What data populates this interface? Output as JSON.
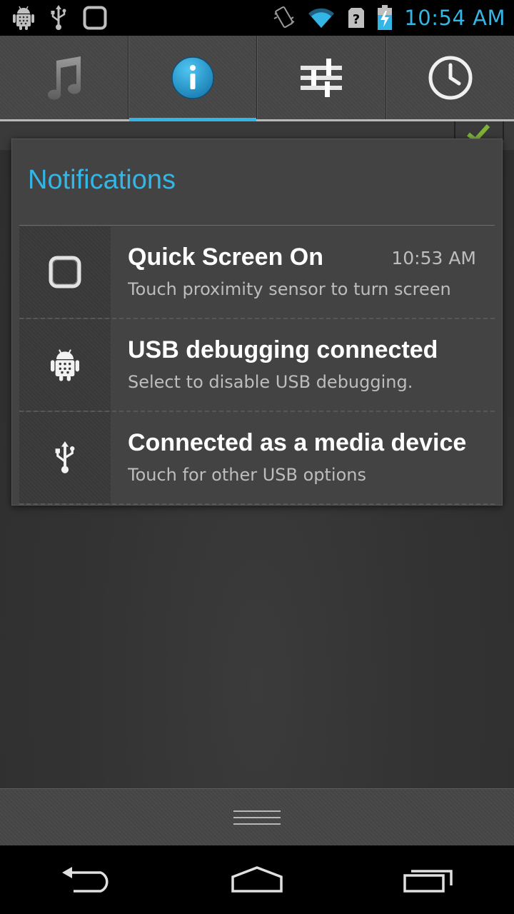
{
  "status_bar": {
    "left_icons": [
      "android-debug-icon",
      "usb-icon",
      "screen-square-icon"
    ],
    "right_icons": [
      "vibrate-icon",
      "wifi-icon",
      "no-sim-icon",
      "battery-charging-icon"
    ],
    "time": "10:54 AM",
    "clock_color": "#33b5e5"
  },
  "tabs": [
    {
      "icon": "music-note-icon",
      "active": false
    },
    {
      "icon": "info-icon",
      "active": true
    },
    {
      "icon": "sliders-icon",
      "active": false
    },
    {
      "icon": "clock-icon",
      "active": false
    }
  ],
  "dialog": {
    "title": "Notifications",
    "title_color": "#33b5e5",
    "notifications": [
      {
        "icon": "square-screen-icon",
        "title": "Quick Screen On",
        "text": "Touch proximity sensor to turn screen",
        "time": "10:53 AM"
      },
      {
        "icon": "android-debug-icon",
        "title": "USB debugging connected",
        "text": "Select to disable USB debugging."
      },
      {
        "icon": "usb-icon",
        "title": "Connected as a media device",
        "text": "Touch for other USB options"
      }
    ]
  },
  "nav_bar": {
    "buttons": [
      "back-icon",
      "home-icon",
      "recent-apps-icon"
    ]
  }
}
